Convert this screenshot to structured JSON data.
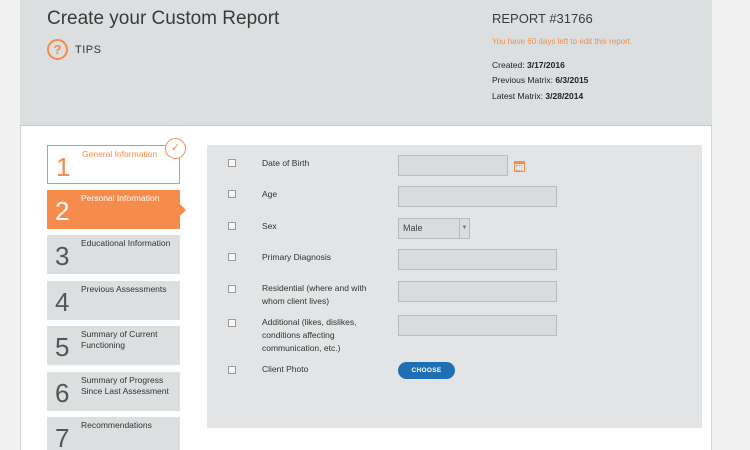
{
  "header": {
    "title": "Create your Custom Report",
    "tips_icon": "?",
    "tips_label": "TIPS",
    "report_number": "REPORT #31766",
    "days_left": "You have 60 days left to edit this report.",
    "created_label": "Created:",
    "created_value": "3/17/2016",
    "previous_label": "Previous Matrix:",
    "previous_value": "6/3/2015",
    "latest_label": "Latest Matrix:",
    "latest_value": "3/28/2014"
  },
  "steps": [
    {
      "num": "1",
      "label": "General Information",
      "state": "done"
    },
    {
      "num": "2",
      "label": "Personal Information",
      "state": "active"
    },
    {
      "num": "3",
      "label": "Educational Information",
      "state": "todo"
    },
    {
      "num": "4",
      "label": "Previous Assessments",
      "state": "todo"
    },
    {
      "num": "5",
      "label": "Summary of Current Functioning",
      "state": "todo"
    },
    {
      "num": "6",
      "label": "Summary of Progress Since Last Assessment",
      "state": "todo"
    },
    {
      "num": "7",
      "label": "Recommendations",
      "state": "todo"
    }
  ],
  "check_icon": "✓",
  "form": {
    "dob_label": "Date of Birth",
    "dob_value": "",
    "age_label": "Age",
    "age_value": "",
    "sex_label": "Sex",
    "sex_value": "Male",
    "diagnosis_label": "Primary Diagnosis",
    "diagnosis_value": "",
    "residential_label": "Residential (where and with whom client lives)",
    "residential_value": "",
    "additional_label": "Additional (likes, dislikes, conditions affecting communication, etc.)",
    "additional_value": "",
    "photo_label": "Client Photo",
    "choose_label": "CHOOSE"
  },
  "colors": {
    "accent": "#f58c4b",
    "button": "#1f6fb5",
    "header_bg": "#dcdfe0"
  }
}
